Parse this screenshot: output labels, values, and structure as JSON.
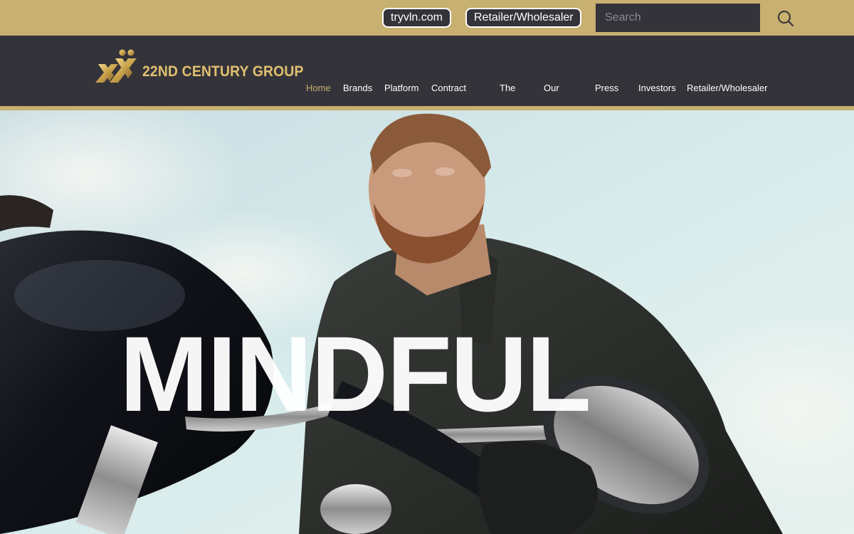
{
  "topbar": {
    "links": [
      "tryvln.com",
      "Retailer/Wholesaler"
    ],
    "search_placeholder": "Search",
    "search_icon": "search-icon"
  },
  "header": {
    "logo_text": "22ND CENTURY GROUP",
    "nav": [
      "Home",
      "Brands",
      "Platform",
      "Contract",
      "The",
      "Our",
      "Press",
      "Investors",
      "Retailer/Wholesaler"
    ],
    "active_nav": "Home"
  },
  "hero": {
    "headline": "MINDFUL"
  },
  "colors": {
    "gold": "#c8b070",
    "dark": "#35333a",
    "white": "#ffffff"
  }
}
